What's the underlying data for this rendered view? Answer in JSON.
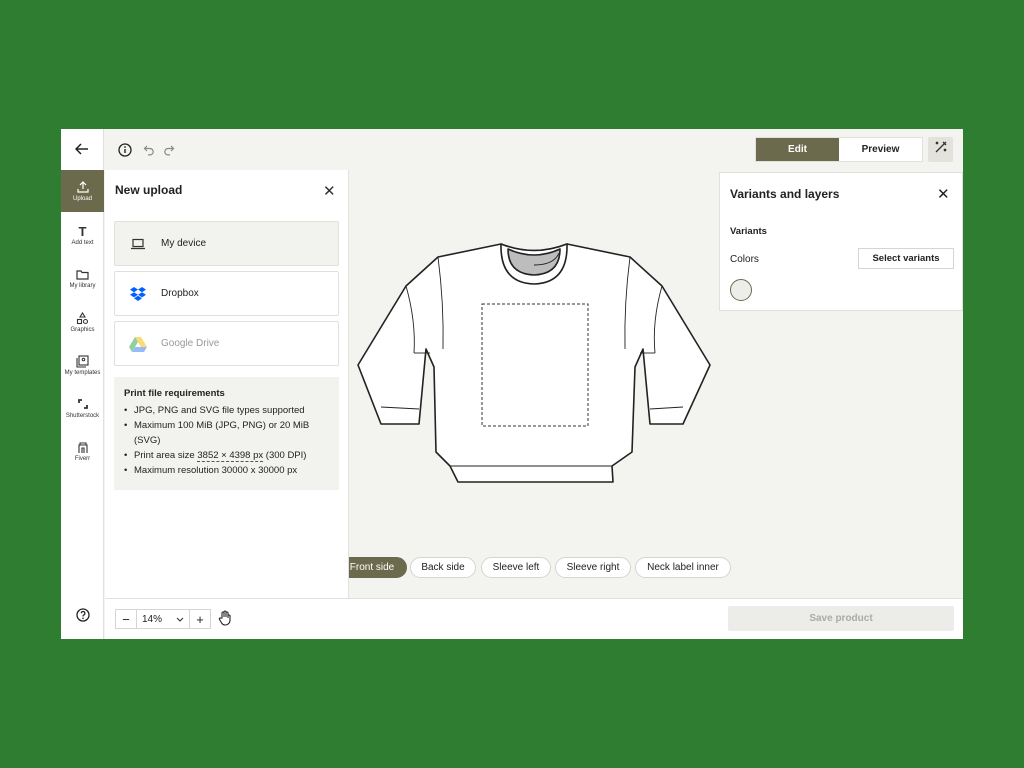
{
  "topbar": {
    "back_icon": "arrow-left-icon",
    "info_icon": "info-icon",
    "undo_icon": "undo-icon",
    "redo_icon": "redo-icon"
  },
  "mode": {
    "edit_label": "Edit",
    "preview_label": "Preview",
    "tool_icon": "magic-wand-icon"
  },
  "rail": {
    "items": [
      {
        "label": "Upload",
        "icon": "upload-icon",
        "active": true
      },
      {
        "label": "Add text",
        "icon": "text-icon"
      },
      {
        "label": "My library",
        "icon": "folder-icon"
      },
      {
        "label": "Graphics",
        "icon": "shapes-icon"
      },
      {
        "label": "My templates",
        "icon": "templates-icon"
      },
      {
        "label": "Shutterstock",
        "icon": "shutterstock-icon"
      },
      {
        "label": "Fiverr",
        "icon": "fiverr-icon"
      }
    ],
    "help_icon": "help-icon"
  },
  "upload_panel": {
    "title": "New upload",
    "sources": [
      {
        "label": "My device",
        "icon": "laptop-icon"
      },
      {
        "label": "Dropbox",
        "icon": "dropbox-icon"
      },
      {
        "label": "Google Drive",
        "icon": "google-drive-icon"
      }
    ],
    "requirements": {
      "title": "Print file requirements",
      "items": [
        "JPG, PNG and SVG file types supported",
        "Maximum 100 MiB (JPG, PNG) or 20 MiB (SVG)"
      ],
      "print_area_prefix": "Print area size ",
      "print_area_value": "3852 × 4398 px",
      "print_area_suffix": " (300 DPI)",
      "max_resolution": "Maximum resolution 30000 x 30000 px"
    }
  },
  "variants_panel": {
    "title": "Variants and layers",
    "section": "Variants",
    "colors_label": "Colors",
    "select_button": "Select variants",
    "swatch_color": "#ededea"
  },
  "view_tabs": [
    "Front side",
    "Back side",
    "Sleeve left",
    "Sleeve right",
    "Neck label inner"
  ],
  "zoom": {
    "minus": "−",
    "value": "14%",
    "plus": "+"
  },
  "save_label": "Save product",
  "colors": {
    "accent": "#6c6a4d",
    "background": "#2f7d31",
    "canvas": "#f3f3ef"
  }
}
